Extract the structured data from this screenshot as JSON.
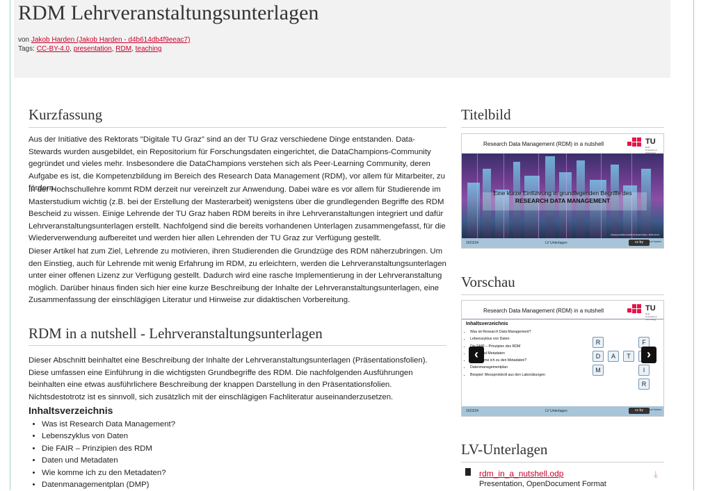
{
  "header": {
    "title": "RDM Lehrveranstaltungsunterlagen",
    "author_prefix": "von",
    "author": "Jakob Harden (Jakob Harden - d4b614db4f9eeac7)",
    "tags_prefix": "Tags:",
    "tags": [
      "CC-BY-4.0",
      "presentation",
      "RDM",
      "teaching"
    ],
    "tag_separator": ","
  },
  "summary": {
    "heading": "Kurzfassung",
    "paragraphs": [
      "Aus der Initiative des Rektorats \"Digitale TU Graz\" sind an der TU Graz verschiedene Dinge entstanden. Data-Stewards wurden ausgebildet, ein Repositorium für Forschungsdaten eingerichtet, die DataChampions-Community gegründet und vieles mehr. Insbesondere die DataChampions verstehen sich als Peer-Learning Community, deren Aufgabe es ist, die Kompetenzbildung im Bereich des Research Data Management (RDM), vor allem für Mitarbeiter, zu fördern.",
      "In der Hochschullehre kommt RDM derzeit nur vereinzelt zur Anwendung. Dabei wäre es vor allem für Studierende im Masterstudium wichtig (z.B. bei der Erstellung der Masterarbeit) wenigstens über die grundlegenden Begriffe des RDM Bescheid zu wissen. Einige Lehrende der TU Graz haben RDM bereits in ihre Lehrveranstaltungen integriert und dafür Lehrveranstaltungsunterlagen erstellt. Nachfolgend sind die bereits vorhandenen Unterlagen zusammengefasst, für die Wiederverwendung aufbereitet und werden hier allen Lehrenden der TU Graz zur Verfügung gestellt.",
      "Dieser Artikel hat zum Ziel, Lehrende zu motivieren, ihren Studierenden die Grundzüge des RDM näherzubringen. Um den Einstieg, auch für Lehrende mit wenig Erfahrung im RDM, zu erleichtern, werden die Lehrveranstaltungsunterlagen unter einer offenen Lizenz zur Verfügung gestellt. Dadurch wird eine rasche Implementierung in der Lehrveranstaltung möglich. Darüber hinaus finden sich hier eine kurze Beschreibung der Inhalte der Lehrveranstaltungsunterlagen, eine Zusammenfassung der einschlägigen Literatur und Hinweise zur didaktischen Vorbereitung."
    ]
  },
  "nutshell": {
    "heading": "RDM in a nutshell - Lehrveranstaltungsunterlagen",
    "paragraph": "Dieser Abschnitt beinhaltet eine Beschreibung der Inhalte der Lehrveranstaltungsunterlagen (Präsentationsfolien). Diese umfassen eine Einführung in die wichtigsten Grundbegriffe des RDM. Die nachfolgenden Ausführungen beinhalten eine etwas ausführlichere Beschreibung der knappen Darstellung in den Präsentationsfolien. Nichtsdestotrotz ist es sinnvoll, sich zusätzlich mit der einschlägigen Fachliteratur auseinanderzusetzen.",
    "toc_heading": "Inhaltsverzeichnis",
    "toc_items": [
      "Was ist Research Data Management?",
      "Lebenszyklus von Daten",
      "Die FAIR – Prinzipien des RDM",
      "Daten und Metadaten",
      "Wie komme ich zu den Metadaten?",
      "Datenmanagementplan (DMP)"
    ]
  },
  "sidebar": {
    "cover_heading": "Titelbild",
    "preview_heading": "Vorschau",
    "materials_heading": "LV-Unterlagen"
  },
  "cover_slide": {
    "title": "Research Data Management (RDM) in a nutshell",
    "logo_text": "TU",
    "logo_suffix": "Graz",
    "logo_sub": "Graz University of Technology",
    "line1": "Eine kurze Einführung in grundlegenden Begriffe des",
    "line2": "RESEARCH DATA MANAGEMENT",
    "credit": "Hintergrundbild erstellt mit Dreamfusion, 2023-12-01",
    "footer_year": "2023/24",
    "footer_mid": "LV Unterlagen",
    "footer_cc": "cc by",
    "footer_name": "Jakob Harden"
  },
  "preview_slide": {
    "title": "Research Data Management (RDM) in a nutshell",
    "toc_title": "Inhaltsverzeichnis",
    "items": [
      "Was ist Research Data Management?",
      "Lebenszyklus von Daten",
      "Die FAIR – Prinzipien des RDM",
      "Daten und Metadaten",
      "Wie komme ich zu den Metadaten?",
      "Datenmanagementplan",
      "Beispiel: Messprotokoll aus den Laborübungen"
    ],
    "tiles": {
      "r1": "R",
      "f": "F",
      "d": "D",
      "a1": "A",
      "t": "T",
      "a2": "A",
      "m": "M",
      "i": "I",
      "r2": "R"
    },
    "prev_glyph": "‹",
    "next_glyph": "›",
    "footer_year": "2023/24",
    "footer_mid": "LV Unterlagen",
    "footer_cc": "cc by",
    "footer_name": "Jakob Harden"
  },
  "file": {
    "name": "rdm_in_a_nutshell.odp",
    "type": "Presentation, OpenDocument Format",
    "icon": "file-icon",
    "download_glyph": "⤓"
  },
  "colors": {
    "link": "#c8002a",
    "frame_border": "#9fd4b4",
    "header_bg": "#f2f2f2"
  }
}
